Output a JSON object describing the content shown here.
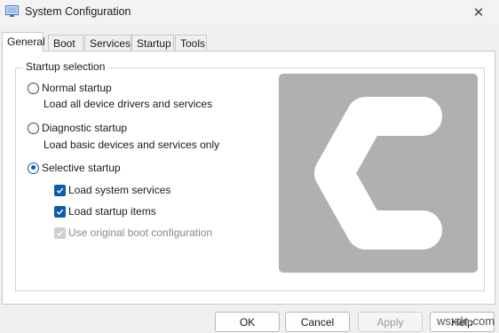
{
  "window": {
    "title": "System Configuration",
    "close_glyph": "✕",
    "icon": "msconfig-icon"
  },
  "tabs": [
    {
      "label": "General",
      "active": true
    },
    {
      "label": "Boot"
    },
    {
      "label": "Services"
    },
    {
      "label": "Startup"
    },
    {
      "label": "Tools"
    }
  ],
  "startup_selection": {
    "legend": "Startup selection",
    "normal": {
      "label": "Normal startup",
      "desc": "Load all device drivers and services",
      "checked": false
    },
    "diagnostic": {
      "label": "Diagnostic startup",
      "desc": "Load basic devices and services only",
      "checked": false
    },
    "selective": {
      "label": "Selective startup",
      "checked": true,
      "options": [
        {
          "label": "Load system services",
          "checked": true,
          "enabled": true
        },
        {
          "label": "Load startup items",
          "checked": true,
          "enabled": true
        },
        {
          "label": "Use original boot configuration",
          "checked": true,
          "enabled": false
        }
      ]
    }
  },
  "buttons": {
    "ok": "OK",
    "cancel": "Cancel",
    "apply": "Apply",
    "help": "Help"
  },
  "watermark": "wsxdn.com",
  "colors": {
    "accent": "#0b5cad",
    "logo_bg": "#b0b0b0",
    "logo_fg": "#ffffff"
  }
}
